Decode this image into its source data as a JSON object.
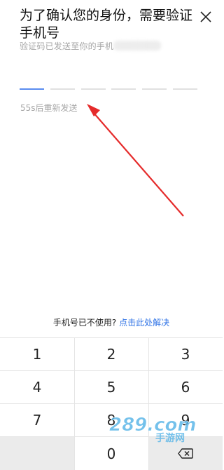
{
  "header": {
    "title": "为了确认您的身份，需要验证手机号",
    "subtitle": "验证码已发送至你的手机"
  },
  "code": {
    "boxes": [
      "",
      "",
      "",
      "",
      "",
      ""
    ],
    "active_index": 0
  },
  "resend": {
    "countdown": "55s后重新发送"
  },
  "help": {
    "question": "手机号已不使用?",
    "link": "点击此处解决"
  },
  "keypad": {
    "keys": [
      "1",
      "2",
      "3",
      "4",
      "5",
      "6",
      "7",
      "8",
      "9",
      "0"
    ]
  },
  "watermark": {
    "brand": "289.com",
    "caption": "手游网"
  },
  "colors": {
    "accent": "#2f73e6",
    "active_underline": "#5a8cf0",
    "annotation_arrow": "#e52b2b"
  }
}
